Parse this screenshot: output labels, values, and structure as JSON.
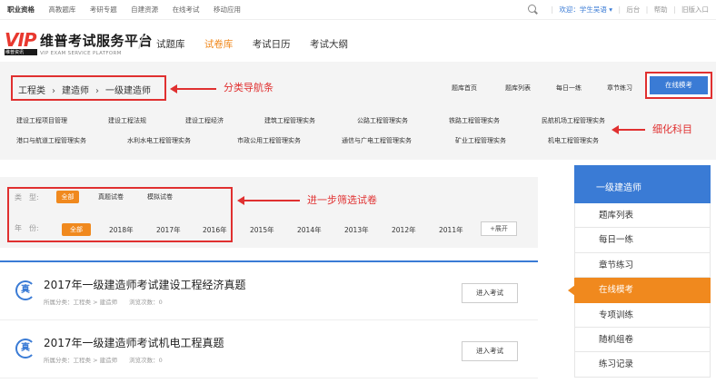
{
  "topbar": {
    "left_links": [
      "职业资格",
      "高教题库",
      "考研专题",
      "自建资源",
      "在线考试",
      "移动应用"
    ],
    "welcome": "欢迎：学生吴语 ▾",
    "right_links": [
      "后台",
      "帮助",
      "旧版入口"
    ]
  },
  "header": {
    "logo_text": "VIP",
    "logo_sub": "维普资讯",
    "brand_name": "维普考试服务平台",
    "brand_en": "VIP EXAM SERVICE PLATFORM",
    "nav": [
      "试题库",
      "试卷库",
      "考试日历",
      "考试大纲"
    ],
    "active_nav": "试卷库"
  },
  "breadcrumb": {
    "items": [
      "工程类",
      "建造师",
      "一级建造师"
    ],
    "separator": "›"
  },
  "annotations": {
    "breadcrumb": "分类导航条",
    "subjects": "细化科目",
    "filter": "进一步筛选试卷"
  },
  "quick_links": [
    "题库首页",
    "题库列表",
    "每日一练",
    "章节练习"
  ],
  "online_exam_button": "在线模考",
  "subjects_row1": [
    "建设工程项目管理",
    "建设工程法规",
    "建设工程经济",
    "建筑工程管理实务",
    "公路工程管理实务",
    "铁路工程管理实务",
    "民航机场工程管理实务"
  ],
  "subjects_row2": [
    "港口与航道工程管理实务",
    "水利水电工程管理实务",
    "市政公用工程管理实务",
    "通信与广电工程管理实务",
    "矿业工程管理实务",
    "机电工程管理实务"
  ],
  "filter": {
    "type_label": "类　型:",
    "types": [
      "全部",
      "真题试卷",
      "模拟试卷"
    ],
    "year_label": "年　份:",
    "years": [
      "全部",
      "2018年",
      "2017年",
      "2016年",
      "2015年",
      "2014年",
      "2013年",
      "2012年",
      "2011年"
    ],
    "expand": "+展开"
  },
  "exams": [
    {
      "badge": "真",
      "title": "2017年一级建造师考试建设工程经济真题",
      "meta": "所属分类：工程类 > 建造师　　浏览次数：0",
      "action": "进入考试"
    },
    {
      "badge": "真",
      "title": "2017年一级建造师考试机电工程真题",
      "meta": "所属分类：工程类 > 建造师　　浏览次数：0",
      "action": "进入考试"
    }
  ],
  "sidebar": {
    "head": "一级建造师",
    "items": [
      "题库列表",
      "每日一练",
      "章节练习",
      "在线模考",
      "专项训练",
      "随机组卷",
      "练习记录"
    ],
    "active": "在线模考"
  },
  "colors": {
    "accent_blue": "#3a7bd5",
    "accent_orange": "#f0891e",
    "annotation_red": "#e03030"
  }
}
